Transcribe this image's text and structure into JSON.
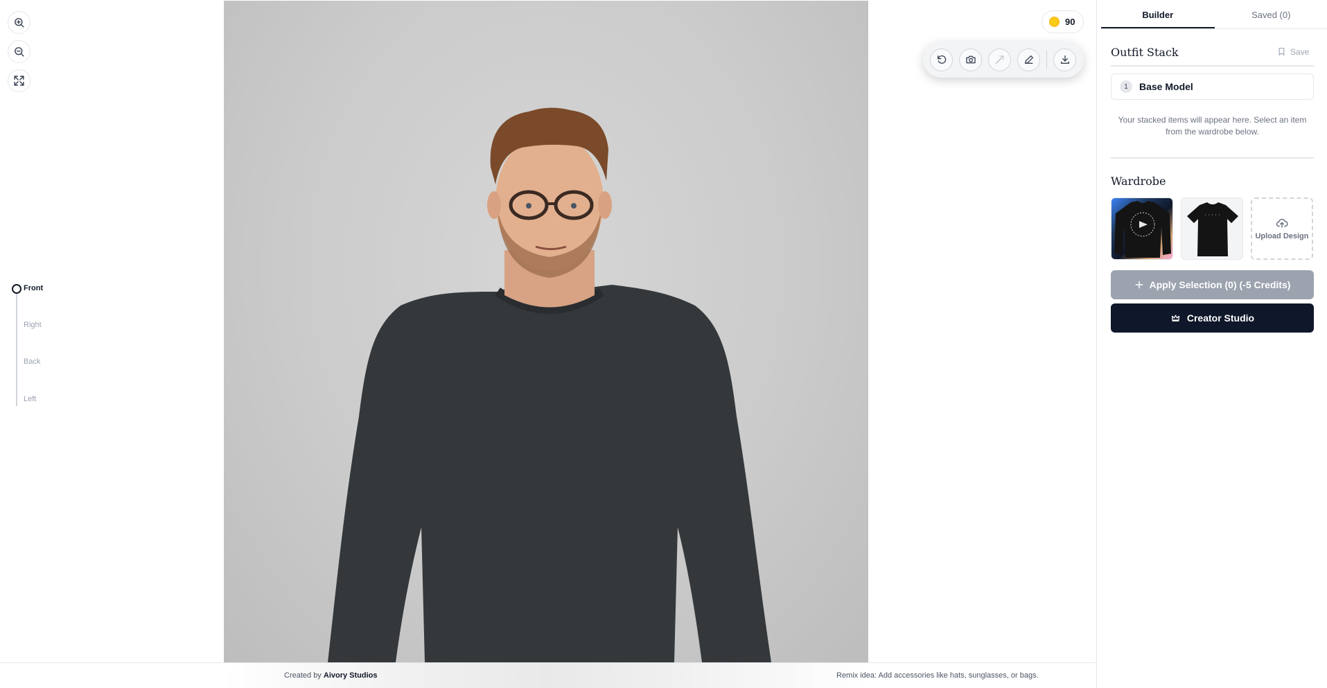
{
  "zoom_controls": {
    "zoom_in_icon": "zoom-in-icon",
    "zoom_out_icon": "zoom-out-icon",
    "fit_icon": "expand-icon"
  },
  "views": {
    "items": [
      "Front",
      "Right",
      "Back",
      "Left"
    ],
    "active": "Front"
  },
  "credits": {
    "value": "90",
    "coin_color": "#facc15"
  },
  "toolbar": {
    "icons": [
      "undo-icon",
      "camera-icon",
      "magic-wand-icon",
      "pen-icon",
      "download-icon"
    ]
  },
  "footer": {
    "created_prefix": "Created by",
    "created_name": "Aivory Studios",
    "remix": "Remix idea: Add accessories like hats, sunglasses, or bags."
  },
  "panel": {
    "tabs": [
      "Builder",
      "Saved (0)"
    ],
    "active_tab": "Builder",
    "outfit_stack": {
      "title": "Outfit Stack",
      "save_label": "Save",
      "items": [
        {
          "num": "1",
          "label": "Base Model"
        }
      ],
      "hint": "Your stacked items will appear here. Select an item from the wardrobe below."
    },
    "wardrobe": {
      "title": "Wardrobe",
      "upload_label": "Upload Design"
    },
    "apply_label": "Apply Selection (0) (-5 Credits)",
    "creator_label": "Creator Studio"
  },
  "colors": {
    "accent_dark": "#0f172a",
    "disabled_button": "#9ca3af"
  }
}
